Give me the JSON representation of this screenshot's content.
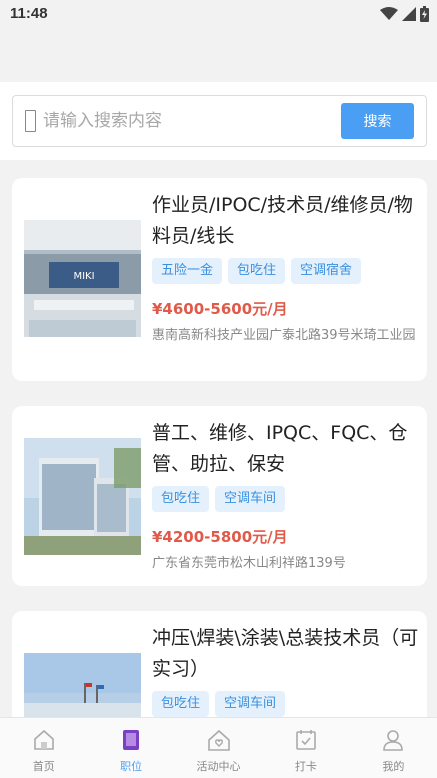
{
  "status": {
    "time": "11:48"
  },
  "search": {
    "placeholder": "请输入搜索内容",
    "button_label": "搜索"
  },
  "jobs": [
    {
      "title": "作业员/IPOC/技术员/维修员/物料员/线长",
      "tags": [
        "五险一金",
        "包吃住",
        "空调宿舍"
      ],
      "salary": "¥4600-5600元/月",
      "address": "惠南高新科技产业园广泰北路39号米琦工业园"
    },
    {
      "title": "普工、维修、IPQC、FQC、仓管、助拉、保安",
      "tags": [
        "包吃住",
        "空调车间"
      ],
      "salary": "¥4200-5800元/月",
      "address": "广东省东莞市松木山利祥路139号"
    },
    {
      "title": "冲压\\焊装\\涂装\\总装技术员（可实习）",
      "tags": [
        "包吃住",
        "空调车间"
      ],
      "salary": "",
      "address": ""
    }
  ],
  "tabbar": {
    "items": [
      {
        "label": "首页",
        "icon": "home-icon"
      },
      {
        "label": "职位",
        "icon": "jobs-icon",
        "active": true
      },
      {
        "label": "活动中心",
        "icon": "activity-icon"
      },
      {
        "label": "打卡",
        "icon": "checkin-icon"
      },
      {
        "label": "我的",
        "icon": "profile-icon"
      }
    ]
  },
  "colors": {
    "accent": "#4a9ff5",
    "salary": "#e05a4a",
    "tag_bg": "#e4f1fc",
    "tag_text": "#3a8fe0"
  }
}
